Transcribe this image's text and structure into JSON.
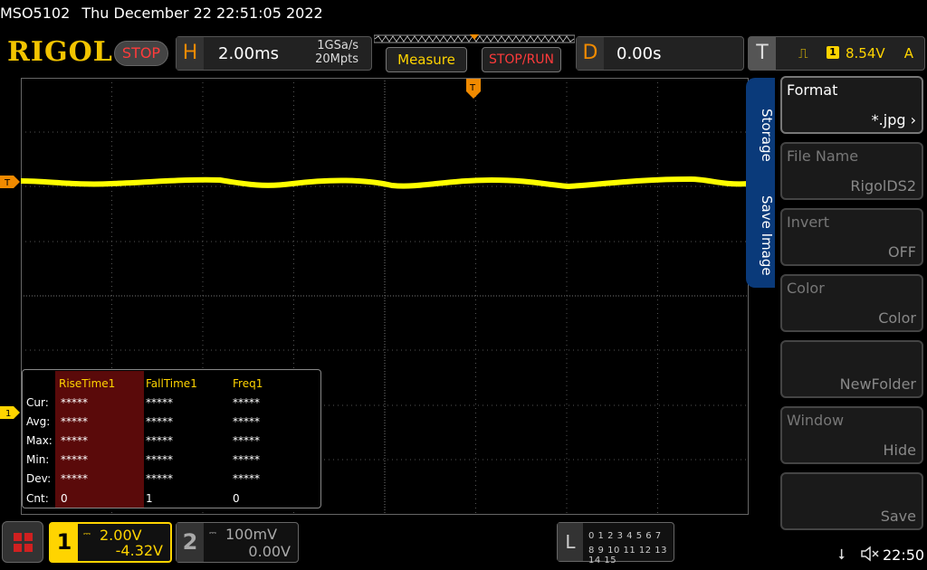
{
  "header": {
    "model": "MSO5102",
    "datetime": "Thu December 22 22:51:05 2022",
    "logo": "RIGOL",
    "run_state": "STOP"
  },
  "horizontal": {
    "letter": "H",
    "timebase": "2.00ms",
    "sample_rate": "1GSa/s",
    "memory_depth": "20Mpts"
  },
  "buttons": {
    "measure": "Measure",
    "stop_run": "STOP/RUN"
  },
  "delay": {
    "letter": "D",
    "value": "0.00s"
  },
  "trigger": {
    "letter": "T",
    "slope_icon": "rising-edge-icon",
    "source": "1",
    "level": "8.54V",
    "mode": "A"
  },
  "markers": {
    "trigger_left": "T",
    "ch1_left": "1",
    "trigger_top": "T"
  },
  "measurements": {
    "columns": [
      "RiseTime1",
      "FallTime1",
      "Freq1"
    ],
    "rows": [
      {
        "label": "Cur:",
        "values": [
          "*****",
          "*****",
          "*****"
        ]
      },
      {
        "label": "Avg:",
        "values": [
          "*****",
          "*****",
          "*****"
        ]
      },
      {
        "label": "Max:",
        "values": [
          "*****",
          "*****",
          "*****"
        ]
      },
      {
        "label": "Min:",
        "values": [
          "*****",
          "*****",
          "*****"
        ]
      },
      {
        "label": "Dev:",
        "values": [
          "*****",
          "*****",
          "*****"
        ]
      },
      {
        "label": "Cnt:",
        "values": [
          "0",
          "1",
          "0"
        ]
      }
    ]
  },
  "side_tabs": {
    "storage": "Storage",
    "save_image": "Save Image"
  },
  "menu": [
    {
      "title": "Format",
      "value": "*.jpg"
    },
    {
      "title": "File Name",
      "value": "RigolDS2"
    },
    {
      "title": "Invert",
      "value": "OFF"
    },
    {
      "title": "Color",
      "value": "Color"
    },
    {
      "title": "",
      "value": "NewFolder"
    },
    {
      "title": "Window",
      "value": "Hide"
    },
    {
      "title": "",
      "value": "Save"
    }
  ],
  "channels": {
    "ch1": {
      "num": "1",
      "scale": "2.00V",
      "offset": "-4.32V",
      "color": "#ffd400"
    },
    "ch2": {
      "num": "2",
      "scale": "100mV",
      "offset": "0.00V",
      "color": "#aaaaaa"
    }
  },
  "logic": {
    "letter": "L",
    "row1": "0 1 2 3   4 5 6 7",
    "row2": "8 9 10 11 12 13 14 15"
  },
  "status": {
    "usb_icon": "usb-icon",
    "sound_icon": "sound-muted-icon",
    "time": "22:50"
  },
  "colors": {
    "trace": "#ffff00",
    "accent": "#f08a00",
    "panel_tab": "#0a3a7a"
  }
}
